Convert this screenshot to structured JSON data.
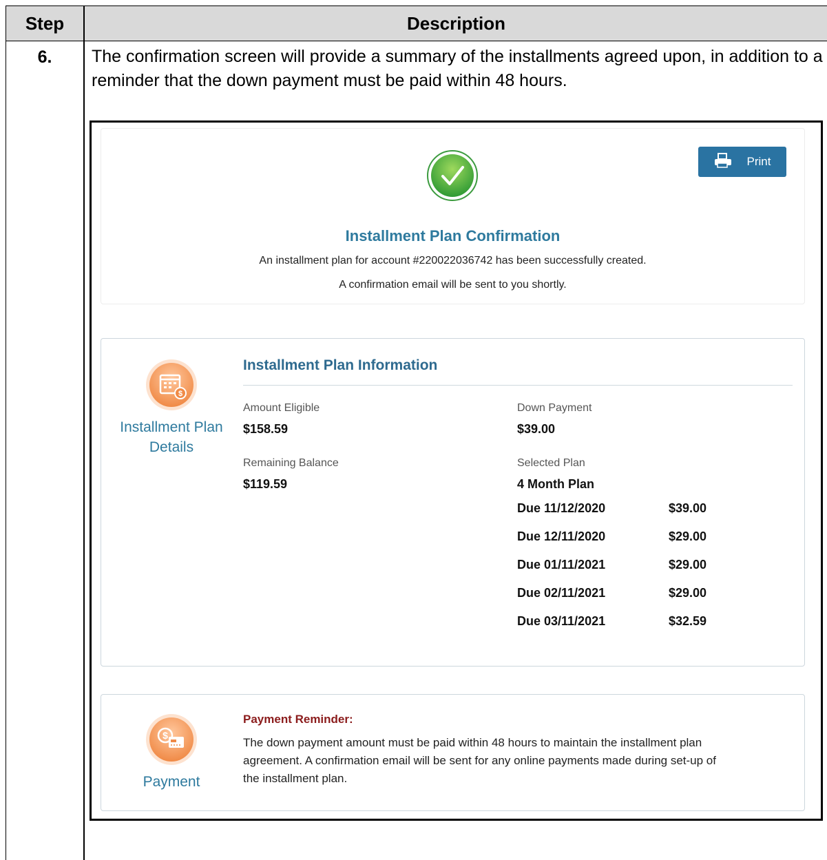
{
  "table": {
    "header_step": "Step",
    "header_description": "Description",
    "row": {
      "step": "6.",
      "description": "The confirmation screen will provide a summary of the installments agreed upon, in addition to a reminder that the down payment must be paid within 48 hours."
    }
  },
  "screenshot": {
    "print_label": "Print",
    "print_icon": "printer-icon",
    "check_icon": "checkmark-icon",
    "confirm_title": "Installment Plan Confirmation",
    "confirm_line1": "An installment plan for account #220022036742 has been successfully created.",
    "confirm_line2": "A confirmation email will be sent to you shortly.",
    "info": {
      "icon": "calendar-dollar-icon",
      "side_label": "Installment Plan Details",
      "title": "Installment Plan Information",
      "amount_eligible_label": "Amount Eligible",
      "amount_eligible_value": "$158.59",
      "down_payment_label": "Down Payment",
      "down_payment_value": "$39.00",
      "remaining_balance_label": "Remaining Balance",
      "remaining_balance_value": "$119.59",
      "selected_plan_label": "Selected Plan",
      "selected_plan_value": "4 Month Plan",
      "schedule": [
        {
          "due": "Due 11/12/2020",
          "amount": "$39.00"
        },
        {
          "due": "Due 12/11/2020",
          "amount": "$29.00"
        },
        {
          "due": "Due 01/11/2021",
          "amount": "$29.00"
        },
        {
          "due": "Due 02/11/2021",
          "amount": "$29.00"
        },
        {
          "due": "Due 03/11/2021",
          "amount": "$32.59"
        }
      ]
    },
    "payment": {
      "icon": "dollar-card-icon",
      "side_label": "Payment",
      "reminder_title": "Payment Reminder:",
      "reminder_body": "The down payment amount must be paid within 48 hours to maintain the installment plan agreement. A confirmation email will be sent for any online payments made during set-up of the installment plan."
    },
    "colors": {
      "accent_blue": "#2e7a9e",
      "button_blue": "#2a73a2",
      "success_green": "#4caf50",
      "icon_orange": "#f39a5f",
      "reminder_red": "#8b1c1c"
    }
  }
}
